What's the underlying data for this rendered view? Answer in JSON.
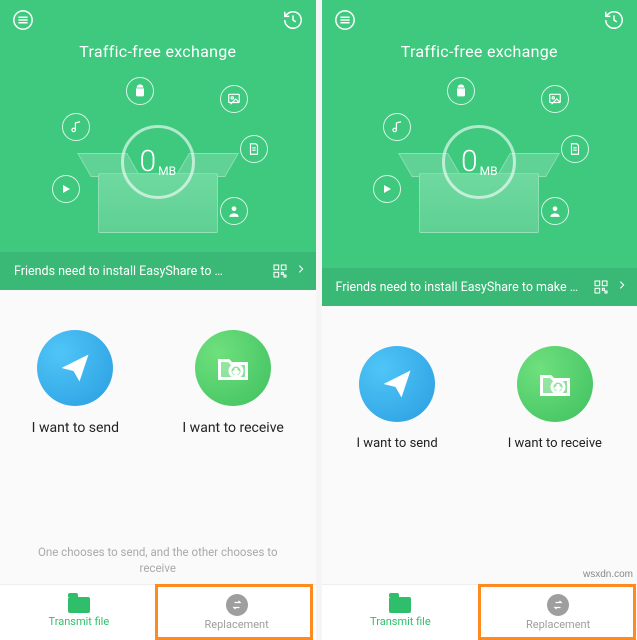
{
  "colors": {
    "primary": "#3ec97f",
    "send": "#2a9ee0",
    "receive": "#3fc060",
    "highlight": "#ff8a1f"
  },
  "screens": [
    {
      "id": "left",
      "header": {
        "title": "Traffic-free exchange",
        "counter_value": "0",
        "counter_unit": "MB",
        "banner_text": "Friends need to install EasyShare to …"
      },
      "actions": {
        "send_label": "I want to send",
        "receive_label": "I want to receive"
      },
      "hint": "One chooses to send, and the other chooses to receive",
      "bottom": {
        "transmit_label": "Transmit file",
        "replacement_label": "Replacement",
        "highlighted": "replacement"
      }
    },
    {
      "id": "right",
      "header": {
        "title": "Traffic-free exchange",
        "counter_value": "0",
        "counter_unit": "MB",
        "banner_text": "Friends need to install EasyShare to make …"
      },
      "actions": {
        "send_label": "I want to send",
        "receive_label": "I want to receive"
      },
      "hint": "",
      "bottom": {
        "transmit_label": "Transmit file",
        "replacement_label": "Replacement",
        "highlighted": "replacement"
      }
    }
  ],
  "watermark": "wsxdn.com"
}
